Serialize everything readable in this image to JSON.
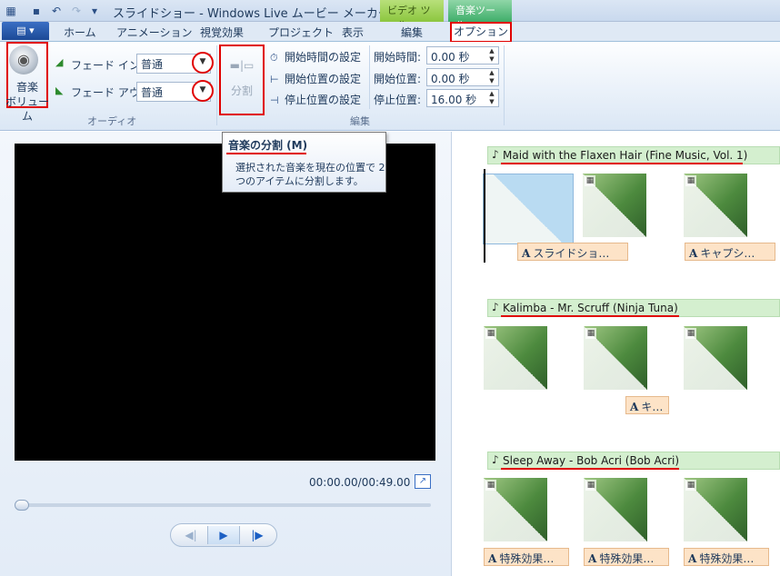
{
  "window": {
    "title": "スライドショー - Windows Live ムービー メーカー",
    "context_tabs": [
      "ビデオ ツール",
      "音楽ツール"
    ]
  },
  "tabs": {
    "file_label": "▤ ▾",
    "items": [
      "ホーム",
      "アニメーション",
      "視覚効果",
      "プロジェクト",
      "表示",
      "編集"
    ],
    "active": "オプション"
  },
  "ribbon": {
    "audio": {
      "volume_label": "音楽\nボリューム",
      "fade_in_label": "フェード イン:",
      "fade_in_value": "普通",
      "fade_out_label": "フェード アウト:",
      "fade_out_value": "普通",
      "group_label": "オーディオ"
    },
    "edit": {
      "split_label": "分割",
      "set_start_time": "開始時間の設定",
      "set_start_point": "開始位置の設定",
      "set_end_point": "停止位置の設定",
      "start_time_label": "開始時間:",
      "start_time_value": "0.00 秒",
      "start_point_label": "開始位置:",
      "start_point_value": "0.00 秒",
      "end_point_label": "停止位置:",
      "end_point_value": "16.00 秒",
      "group_label": "編集"
    }
  },
  "tooltip": {
    "title": "音楽の分割 (M)",
    "body": "選択された音楽を現在の位置で 2 つのアイテムに分割します。"
  },
  "preview": {
    "time": "00:00.00/00:49.00",
    "progress": 0
  },
  "storyboard": {
    "tracks": [
      {
        "name": "Maid with the Flaxen Hair (Fine Music, Vol. 1)",
        "captions": [
          "スライドショ…",
          "キャプシ…"
        ]
      },
      {
        "name": "Kalimba - Mr. Scruff (Ninja Tuna)",
        "captions": [
          "キ…"
        ]
      },
      {
        "name": "Sleep Away - Bob Acri (Bob Acri)",
        "captions": [
          "特殊効果…",
          "特殊効果…",
          "特殊効果…"
        ]
      }
    ]
  },
  "colors": {
    "highlight": "#e00000",
    "track_bg": "#d4efcf",
    "caption_bg": "#fde3c7"
  }
}
